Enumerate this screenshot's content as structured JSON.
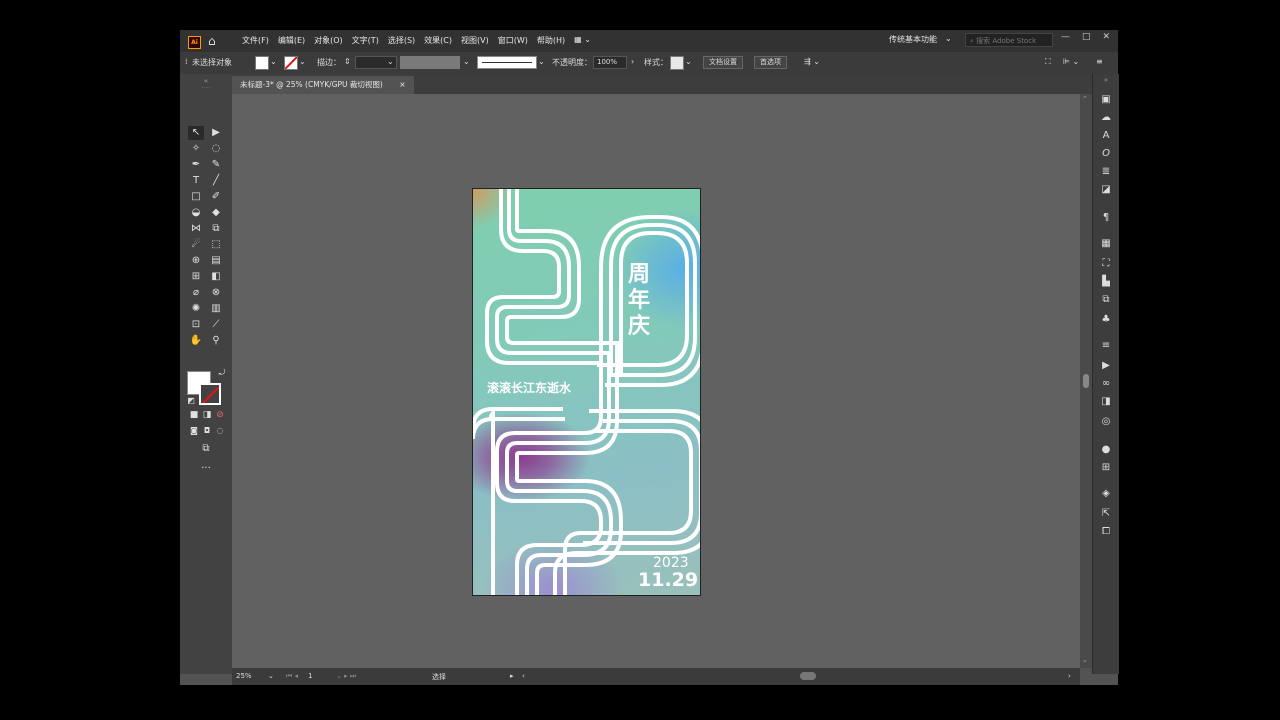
{
  "app": {
    "logo_text": "Ai"
  },
  "menu": [
    "文件(F)",
    "编辑(E)",
    "对象(O)",
    "文字(T)",
    "选择(S)",
    "效果(C)",
    "视图(V)",
    "窗口(W)",
    "帮助(H)"
  ],
  "workspace": {
    "label": "传统基本功能",
    "search_placeholder": "搜索 Adobe Stock"
  },
  "window_controls": {
    "minimize": "—",
    "restore": "□",
    "close": "✕"
  },
  "control_bar": {
    "no_selection": "未选择对象",
    "stroke_label": "描边：",
    "opacity_label": "不透明度：",
    "opacity_value": "100%",
    "style_label": "样式：",
    "doc_setup_button": "文档设置",
    "preferences_button": "首选项"
  },
  "document_tab": {
    "title": "未标题-3* @ 25% (CMYK/GPU 裁切视图)",
    "close": "×"
  },
  "status_bar": {
    "zoom": "25%",
    "page": "1",
    "tool": "选择"
  },
  "artwork": {
    "title_chars": [
      "周",
      "年",
      "庆"
    ],
    "subtitle": "滚滚长江东逝水",
    "year": "2023",
    "date": "11.29"
  },
  "colors": {
    "accent_red": "#e11111",
    "logo_orange": "#ff9a00",
    "art_white": "#ffffff"
  }
}
